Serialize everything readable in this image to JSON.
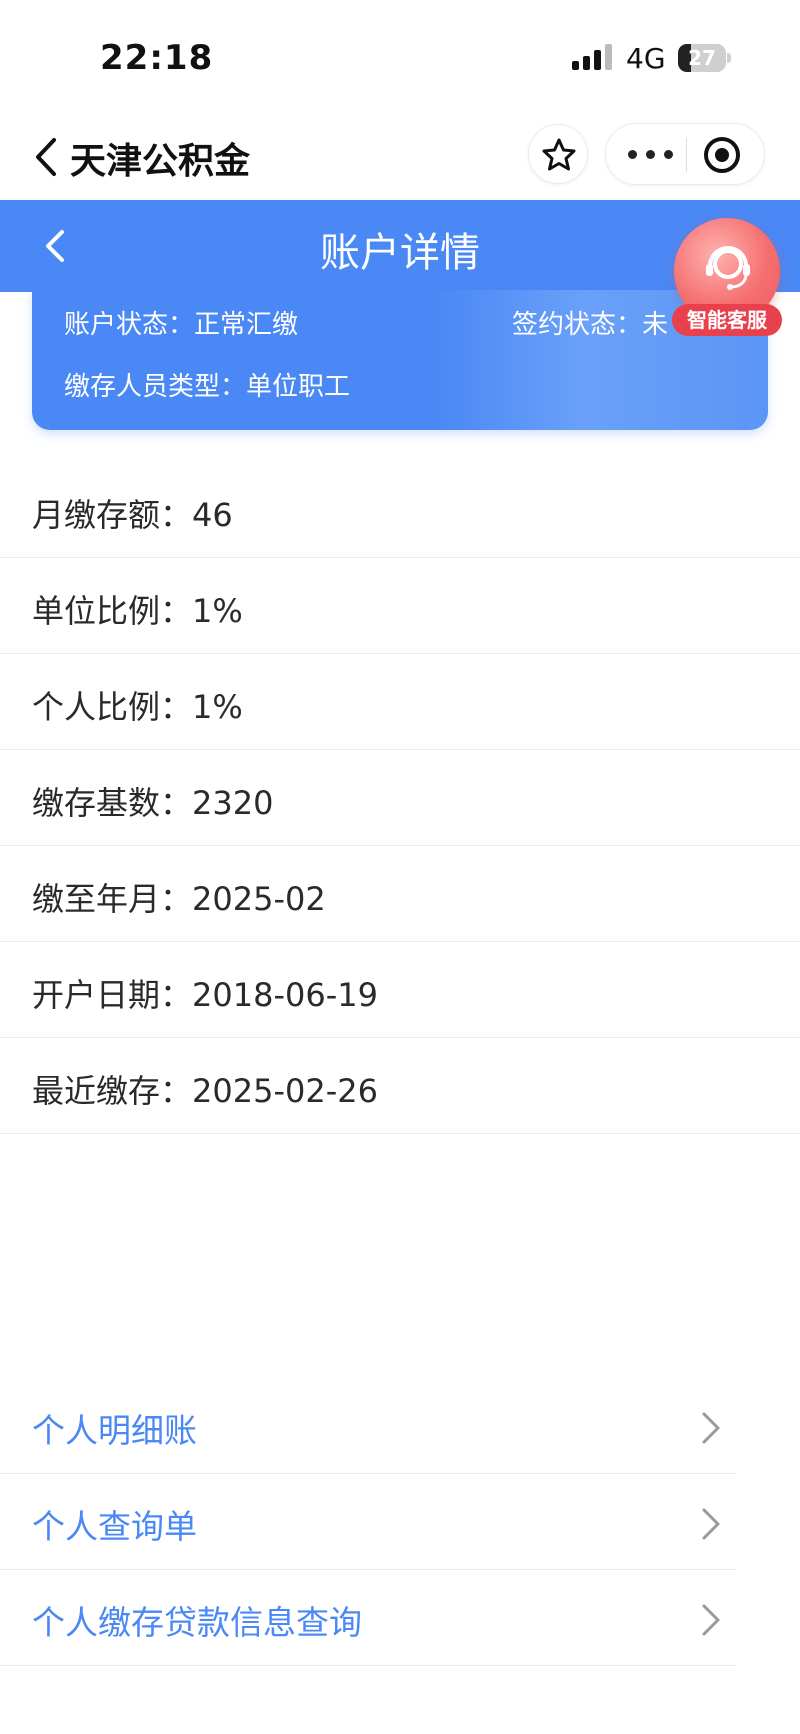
{
  "status_bar": {
    "time": "22:18",
    "network": "4G",
    "battery": "27",
    "battery_percent": 27
  },
  "nav": {
    "title": "天津公积金"
  },
  "header": {
    "title": "账户详情"
  },
  "account_card": {
    "account_status": "账户状态：正常汇缴",
    "sign_status": "签约状态：未",
    "member_type": "缴存人员类型：单位职工"
  },
  "service": {
    "label": "智能客服"
  },
  "info": [
    {
      "text": "月缴存额：46"
    },
    {
      "text": "单位比例：1%"
    },
    {
      "text": "个人比例：1%"
    },
    {
      "text": "缴存基数：2320"
    },
    {
      "text": "缴至年月：2025-02"
    },
    {
      "text": "开户日期：2018-06-19"
    },
    {
      "text": "最近缴存：2025-02-26"
    }
  ],
  "links": [
    {
      "label": "个人明细账"
    },
    {
      "label": "个人查询单"
    },
    {
      "label": "个人缴存贷款信息查询"
    }
  ],
  "colors": {
    "primary": "#4a88f5",
    "service_red": "#e9404e"
  }
}
